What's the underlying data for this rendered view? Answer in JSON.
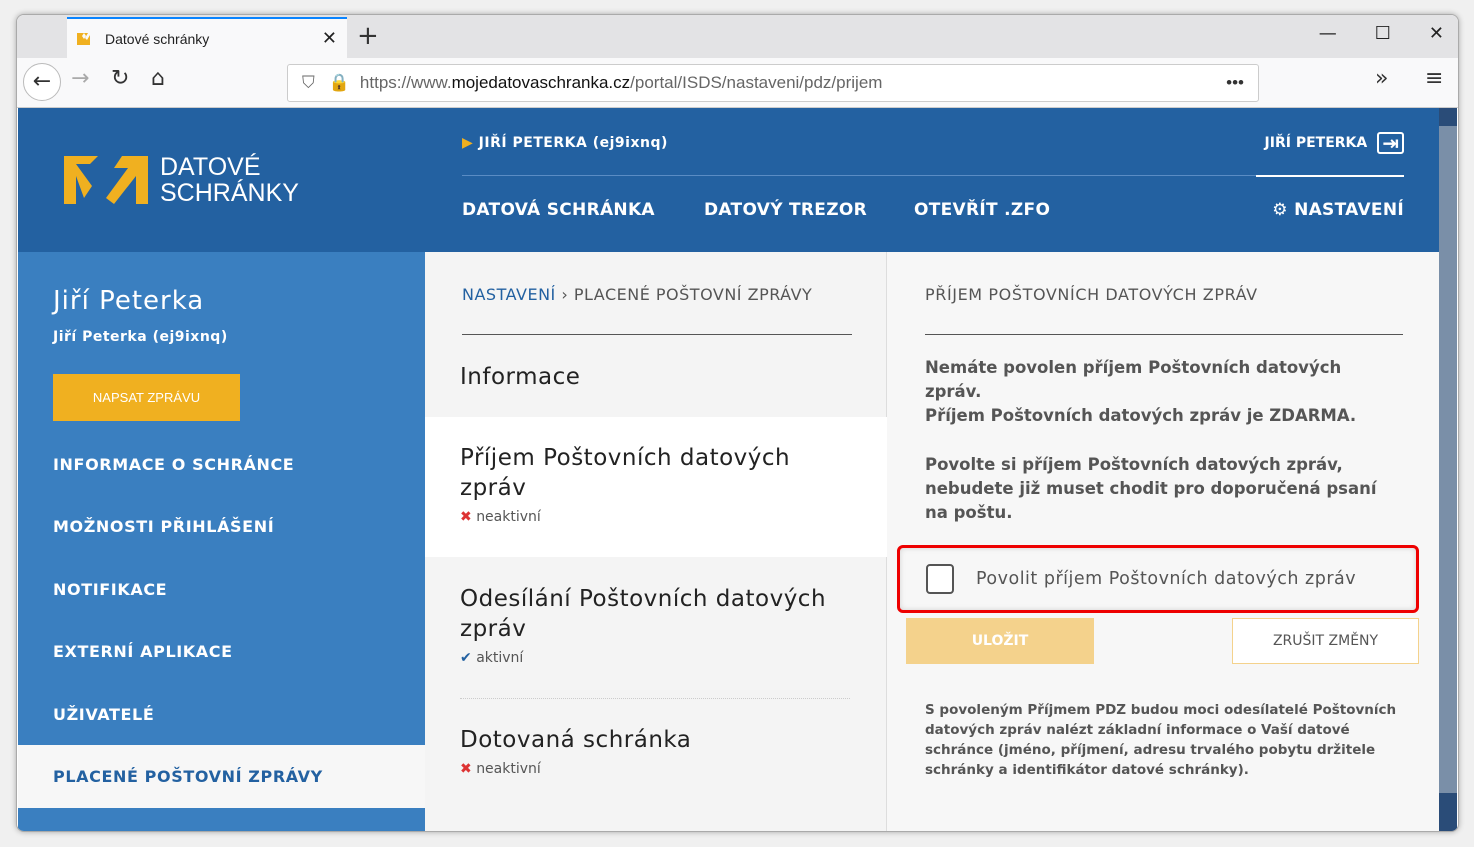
{
  "browser": {
    "tab_title": "Datové schránky",
    "url_prefix": "https://www.",
    "url_domain": "mojedatovaschranka.cz",
    "url_path": "/portal/ISDS/nastaveni/pdz/prijem"
  },
  "header": {
    "logo_line1": "DATOVÉ",
    "logo_line2": "SCHRÁNKY",
    "account": "JIŘÍ PETERKA (ej9ixnq)",
    "user_name": "JIŘÍ PETERKA",
    "nav": [
      "DATOVÁ SCHRÁNKA",
      "DATOVÝ TREZOR",
      "OTEVŘÍT .ZFO"
    ],
    "settings": "NASTAVENÍ"
  },
  "sidebar": {
    "name": "Jiří Peterka",
    "sub": "Jiří Peterka (ej9ixnq)",
    "compose": "NAPSAT ZPRÁVU",
    "items": [
      "INFORMACE O SCHRÁNCE",
      "MOŽNOSTI PŘIHLÁŠENÍ",
      "NOTIFIKACE",
      "EXTERNÍ APLIKACE",
      "UŽIVATELÉ",
      "PLACENÉ POŠTOVNÍ ZPRÁVY"
    ]
  },
  "middle": {
    "crumb_root": "NASTAVENÍ",
    "crumb_current": "PLACENÉ POŠTOVNÍ ZPRÁVY",
    "info": "Informace",
    "items": [
      {
        "title": "Příjem Poštovních datových zpráv",
        "status": "neaktivní"
      },
      {
        "title": "Odesílání Poštovních datových zpráv",
        "status": "aktivní"
      },
      {
        "title": "Dotovaná schránka",
        "status": "neaktivní"
      }
    ]
  },
  "right": {
    "title": "PŘÍJEM POŠTOVNÍCH DATOVÝCH ZPRÁV",
    "p1": "Nemáte povolen příjem Poštovních datových zpráv.",
    "p2": "Příjem Poštovních datových zpráv je ZDARMA.",
    "p3": "Povolte si příjem Poštovních datových zpráv, nebudete již muset chodit pro doporučená psaní na poštu.",
    "checkbox_label": "Povolit příjem Poštovních datových zpráv",
    "save": "ULOŽIT",
    "cancel": "ZRUŠIT ZMĚNY",
    "note": "S povoleným Příjmem PDZ budou moci odesílatelé Poštovních datových zpráv nalézt základní informace o Vaší datové schránce (jméno, příjmení, adresu trvalého pobytu držitele schránky a identifikátor datové schránky)."
  }
}
